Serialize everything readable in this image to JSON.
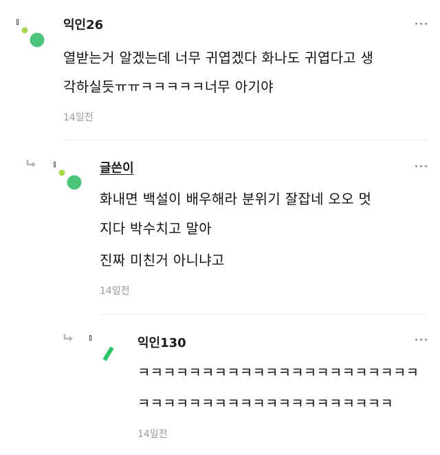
{
  "comments": [
    {
      "author": "익인26",
      "lines": [
        "열받는거 알겠는데 너무 귀엽겠다 화나도 귀엽다고 생",
        "각하실듯ㅠㅠㅋㅋㅋㅋㅋ너무 아기야"
      ],
      "time": "14일전"
    },
    {
      "author": "글쓴이",
      "lines": [
        "화내면 백설이 배우해라 분위기 잘잡네 오오 멋",
        "지다 박수치고 말아",
        "진짜 미친거 아니냐고"
      ],
      "time": "14일전"
    },
    {
      "author": "익인130",
      "lines": [
        "ㅋㅋㅋㅋㅋㅋㅋㅋㅋㅋㅋㅋㅋㅋㅋㅋㅋㅋㅋㅋㅋㅋ",
        "ㅋㅋㅋㅋㅋㅋㅋㅋㅋㅋㅋㅋㅋㅋㅋㅋㅋㅋㅋㅋ"
      ],
      "time": "14일전"
    }
  ],
  "icons": {
    "more": "more-options-icon",
    "reply": "reply-arrow-icon",
    "avatar": "avatar-icon"
  },
  "colors": {
    "avatar_green": "#4cc47c",
    "avatar_lime": "#a8d94a",
    "avatar_stripe": "#2ec46a",
    "text": "#111111",
    "muted": "#999999"
  }
}
